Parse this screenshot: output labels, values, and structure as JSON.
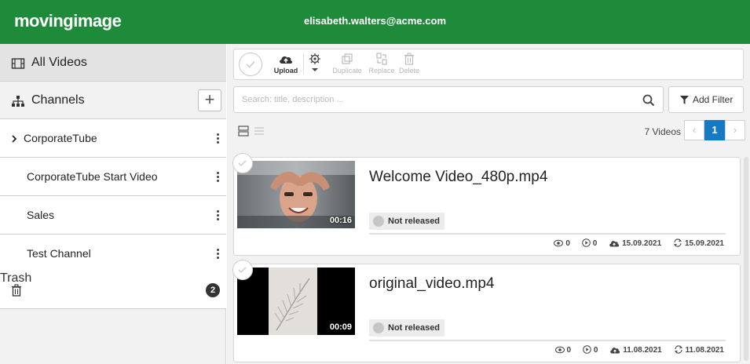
{
  "header": {
    "logo": "movingimage",
    "user_email": "elisabeth.walters@acme.com",
    "brand_color": "#1e8b3a"
  },
  "sidebar": {
    "all_videos": "All Videos",
    "channels_label": "Channels",
    "add_channel": "+",
    "channels": [
      {
        "label": "CorporateTube",
        "expandable": true
      },
      {
        "label": "CorporateTube Start Video",
        "expandable": false
      },
      {
        "label": "Sales",
        "expandable": false
      },
      {
        "label": "Test Channel",
        "expandable": false
      }
    ],
    "trash_label": "Trash",
    "trash_count": "2"
  },
  "toolbar": {
    "upload": "Upload",
    "duplicate": "Duplicate",
    "replace": "Replace",
    "delete": "Delete"
  },
  "search": {
    "placeholder": "Search: title, description ...",
    "value": ""
  },
  "filter": {
    "label": "Add Filter"
  },
  "list": {
    "count_label": "7 Videos",
    "pager": {
      "prev": "‹",
      "current": "1",
      "next": "›"
    },
    "accent_color": "#1579c4"
  },
  "videos": [
    {
      "title": "Welcome Video_480p.mp4",
      "duration": "00:16",
      "status": "Not released",
      "views": "0",
      "plays": "0",
      "uploaded": "15.09.2021",
      "modified": "15.09.2021"
    },
    {
      "title": "original_video.mp4",
      "duration": "00:09",
      "status": "Not released",
      "views": "0",
      "plays": "0",
      "uploaded": "11.08.2021",
      "modified": "11.08.2021"
    }
  ]
}
